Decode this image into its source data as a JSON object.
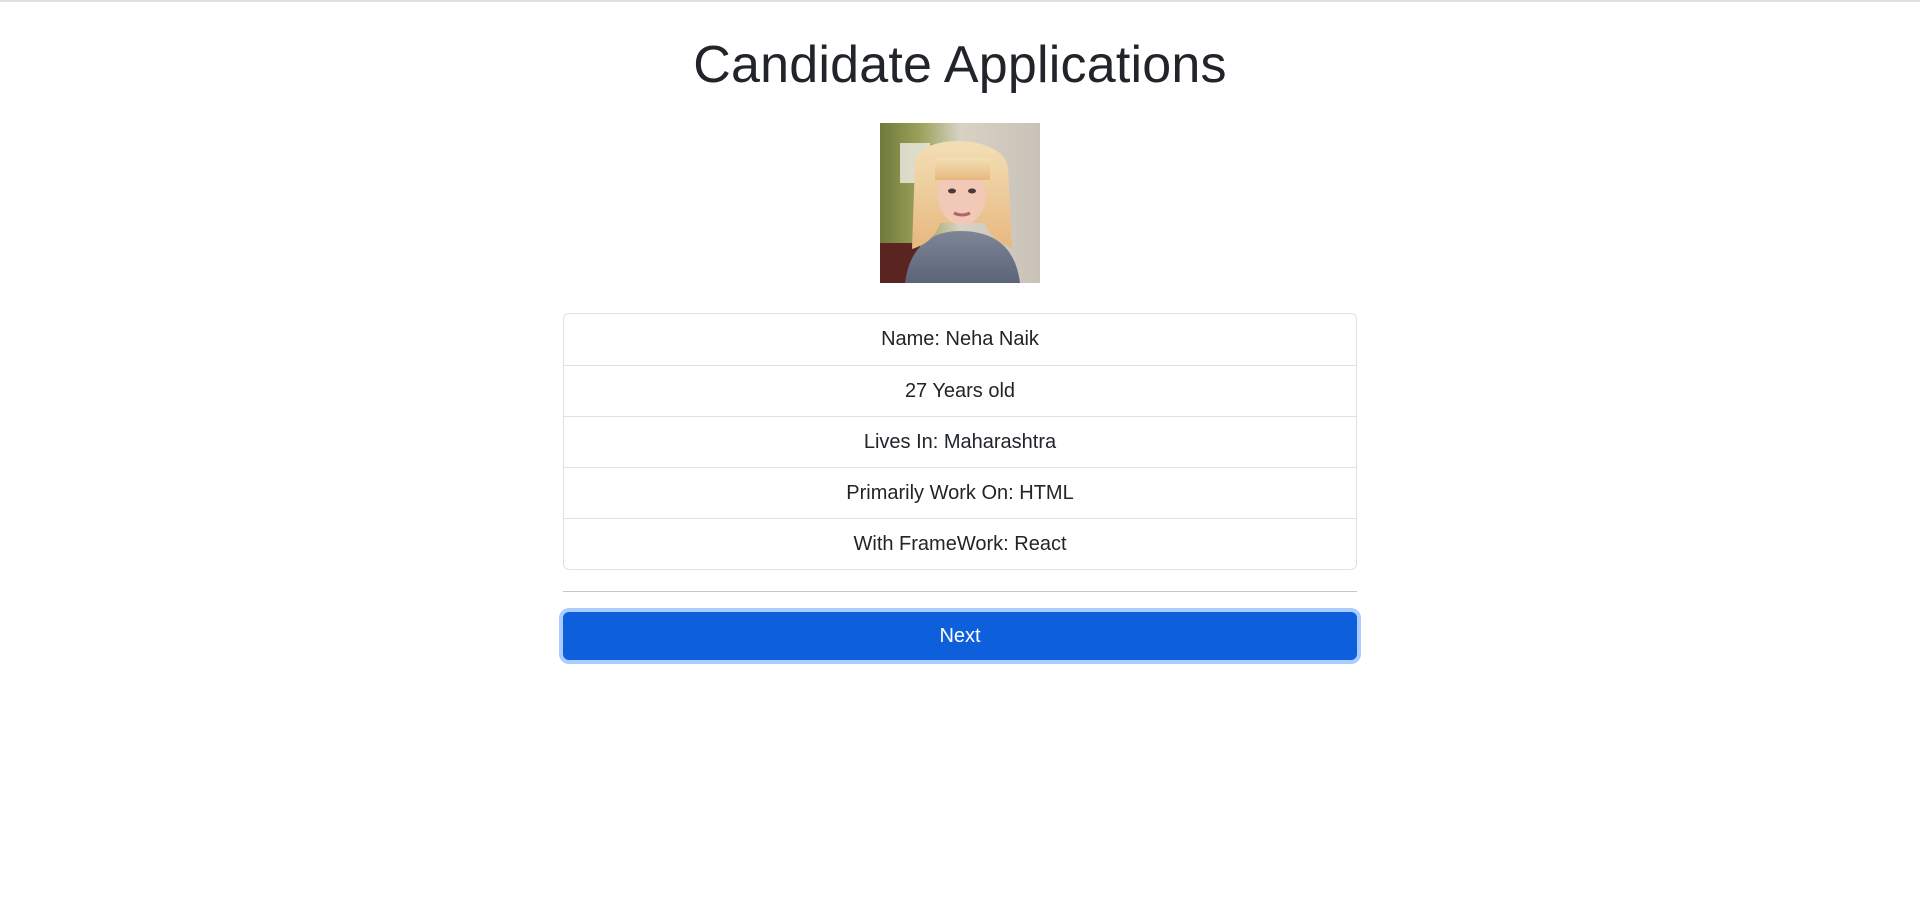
{
  "page": {
    "title": "Candidate Applications"
  },
  "candidate": {
    "photo": "candidate-photo",
    "name": "Name: Neha Naik",
    "age": "27 Years old",
    "location": "Lives In: Maharashtra",
    "primary_work": "Primarily Work On: HTML",
    "framework": "With FrameWork: React"
  },
  "actions": {
    "next_label": "Next"
  },
  "colors": {
    "primary_button": "#0d5fdb",
    "border": "#dee2e6",
    "text": "#212529"
  }
}
